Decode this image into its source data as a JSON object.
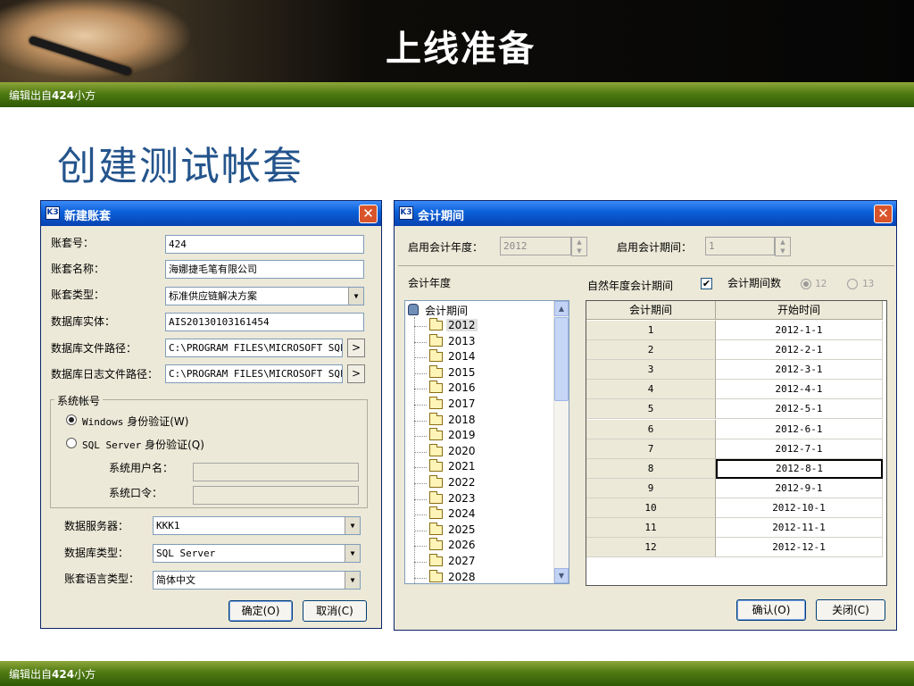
{
  "slide": {
    "title": "上线准备",
    "footer_text": "编辑出自",
    "footer_bold": "424",
    "footer_suffix": "小方",
    "subtitle": "创建测试帐套"
  },
  "new_account_dialog": {
    "title": "新建账套",
    "logo": "K3",
    "close_glyph": "✕",
    "fields": [
      {
        "label": "账套号：",
        "value": "424"
      },
      {
        "label": "账套名称：",
        "value": "海娜捷毛笔有限公司"
      },
      {
        "label": "账套类型：",
        "value": "标准供应链解决方案"
      },
      {
        "label": "数据库实体：",
        "value": "AIS20130103161454"
      },
      {
        "label": "数据库文件路径：",
        "value": "C:\\PROGRAM FILES\\MICROSOFT SQL"
      },
      {
        "label": "数据库日志文件路径：",
        "value": "C:\\PROGRAM FILES\\MICROSOFT SQL"
      }
    ],
    "system_account": {
      "caption": "系统帐号",
      "windows_auth_prefix": "Windows",
      "windows_auth": "身份验证(W)",
      "sql_auth_prefix": "SQL Server",
      "sql_auth": "身份验证(Q)",
      "selected": "windows",
      "username_label": "系统用户名：",
      "password_label": "系统口令："
    },
    "db_server_label": "数据服务器：",
    "db_server_value": "KKK1",
    "db_type_label": "数据库类型：",
    "db_type_value": "SQL Server",
    "language_label": "账套语言类型：",
    "language_value": "简体中文",
    "ok_button": "确定(O)",
    "cancel_button": "取消(C)"
  },
  "period_dialog": {
    "title": "会计期间",
    "logo": "K3",
    "close_glyph": "✕",
    "start_year_label": "启用会计年度：",
    "start_year_value": "2012",
    "start_period_label": "启用会计期间：",
    "start_period_value": "1",
    "fiscal_year_label": "会计年度",
    "natural_year_label": "自然年度会计期间",
    "natural_year_checked": true,
    "check_glyph": "✔",
    "period_count_label": "会计期间数",
    "period_options": [
      "12",
      "13"
    ],
    "period_selected": "12",
    "tree_root": "会计期间",
    "tree_years": [
      "2012",
      "2013",
      "2014",
      "2015",
      "2016",
      "2017",
      "2018",
      "2019",
      "2020",
      "2021",
      "2022",
      "2023",
      "2024",
      "2025",
      "2026",
      "2027",
      "2028"
    ],
    "selected_year": "2012",
    "columns": [
      "会计期间",
      "开始时间"
    ],
    "rows": [
      [
        "1",
        "2012-1-1"
      ],
      [
        "2",
        "2012-2-1"
      ],
      [
        "3",
        "2012-3-1"
      ],
      [
        "4",
        "2012-4-1"
      ],
      [
        "5",
        "2012-5-1"
      ],
      [
        "6",
        "2012-6-1"
      ],
      [
        "7",
        "2012-7-1"
      ],
      [
        "8",
        "2012-8-1"
      ],
      [
        "9",
        "2012-9-1"
      ],
      [
        "10",
        "2012-10-1"
      ],
      [
        "11",
        "2012-11-1"
      ],
      [
        "12",
        "2012-12-1"
      ]
    ],
    "focused_row": 7,
    "confirm_button": "确认(O)",
    "close_button": "关闭(C)"
  }
}
